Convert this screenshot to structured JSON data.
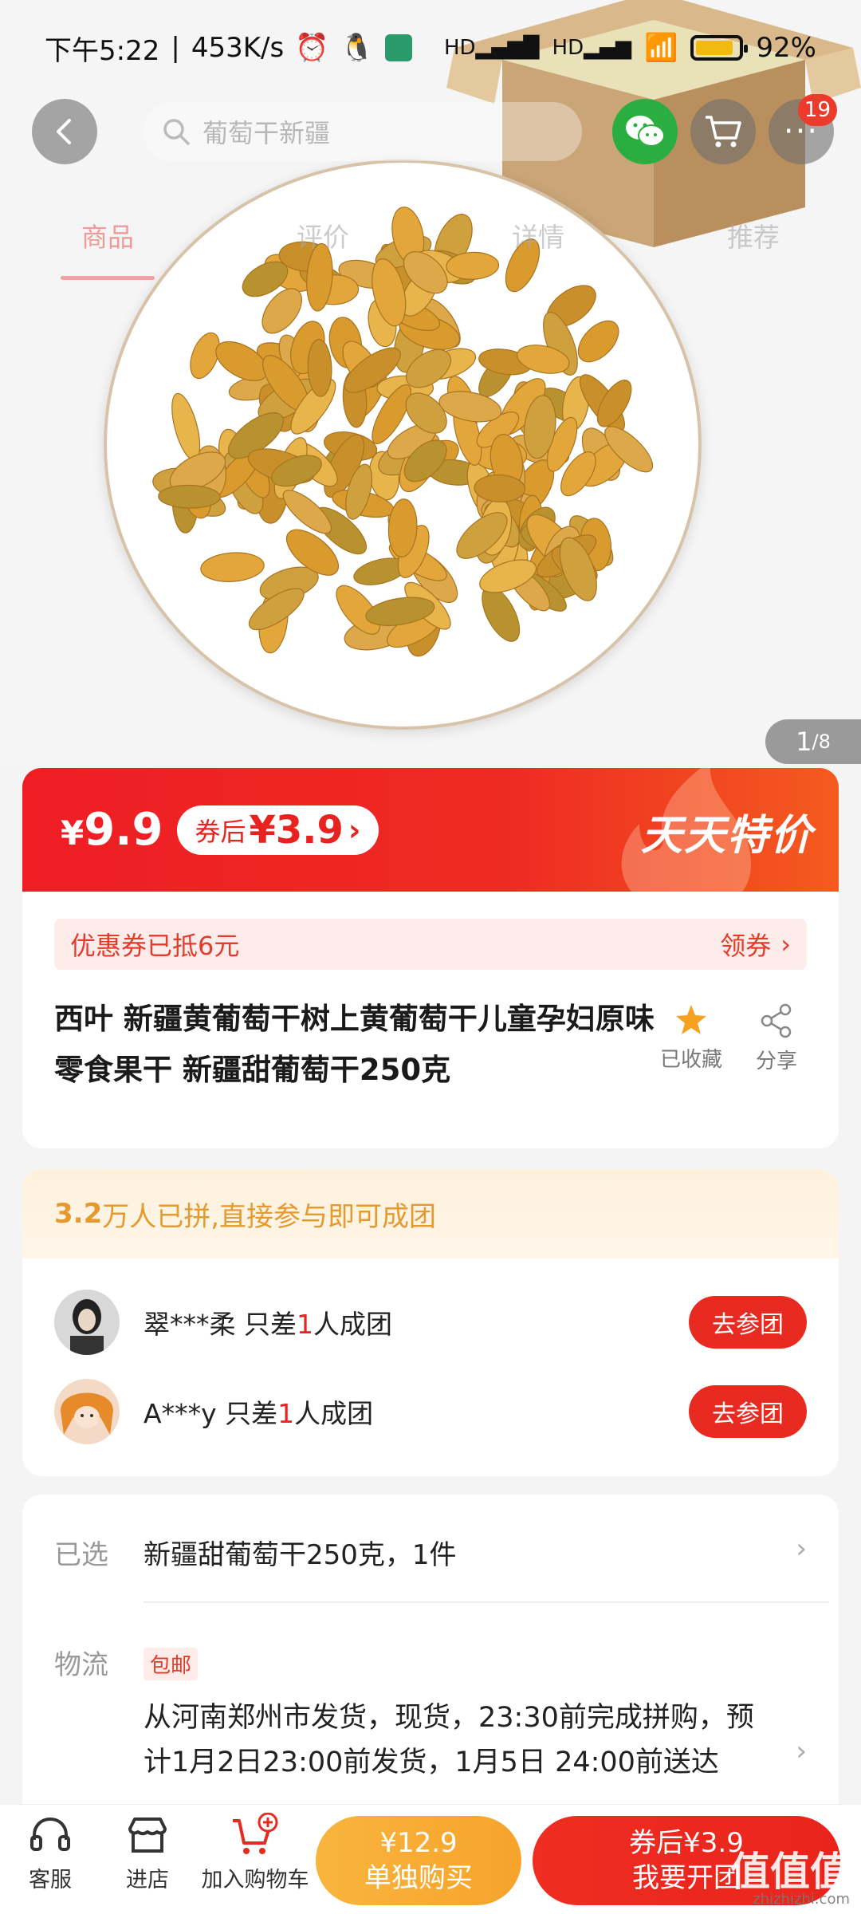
{
  "status": {
    "time": "下午5:22",
    "speed": "453K/s",
    "battery": "92%"
  },
  "nav": {
    "search_placeholder": "葡萄干新疆",
    "more_badge": "19"
  },
  "tabs": [
    {
      "label": "商品",
      "active": true
    },
    {
      "label": "评价",
      "active": false
    },
    {
      "label": "详情",
      "active": false
    },
    {
      "label": "推荐",
      "active": false
    }
  ],
  "pager": {
    "current": "1",
    "total": "/8"
  },
  "price": {
    "yen": "¥",
    "amount": "9.9",
    "coupon_label": "券后",
    "coupon_price": "¥3.9",
    "promo_logo": "天天特价"
  },
  "product": {
    "coupon_note": "优惠券已抵6元",
    "coupon_action": "领券",
    "title": "西叶 新疆黄葡萄干树上黄葡萄干儿童孕妇原味零食果干 新疆甜葡萄干250克",
    "fav_label": "已收藏",
    "share_label": "分享"
  },
  "group": {
    "headline_num": "3.2",
    "headline_rest": "万人已拼,直接参与即可成团",
    "rows": [
      {
        "user": "翠***柔",
        "pre": "只差",
        "num": "1",
        "post": "人成团",
        "button": "去参团"
      },
      {
        "user": "A***y",
        "pre": "只差",
        "num": "1",
        "post": "人成团",
        "button": "去参团"
      }
    ]
  },
  "options": {
    "selected_label": "已选",
    "selected_value": "新疆甜葡萄干250克，1件",
    "shipping_label": "物流",
    "free_shipping_tag": "包邮",
    "shipping_text": "从河南郑州市发货，现货，23:30前完成拼购，预计1月2日23:00前发货，1月5日 24:00前送达"
  },
  "bottom": {
    "service": "客服",
    "shop": "进店",
    "add_cart": "加入购物车",
    "buy_alone_price": "¥12.9",
    "buy_alone_label": "单独购买",
    "buy_group_price": "券后¥3.9",
    "buy_group_label": "我要开团",
    "watermark": "值值值",
    "watermark_url": "zhizhizhi.com"
  }
}
